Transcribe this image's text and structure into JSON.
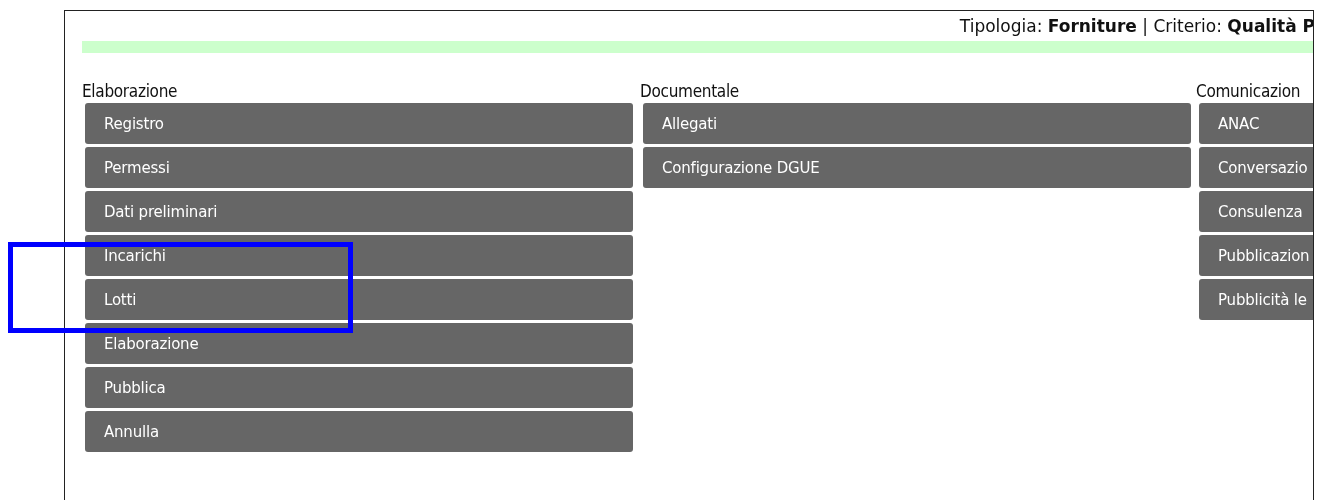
{
  "header": {
    "text": "Tipologia: **Forniture** | Criterio: **Qualità P**"
  },
  "columns": [
    {
      "title": "Elaborazione",
      "items": [
        "Registro",
        "Permessi",
        "Dati preliminari",
        "Incarichi",
        "Lotti",
        "Elaborazione",
        "Pubblica",
        "Annulla"
      ]
    },
    {
      "title": "Documentale",
      "items": [
        "Allegati",
        "Configurazione DGUE"
      ]
    },
    {
      "title": "Comunicazion",
      "items": [
        "ANAC",
        "Conversazio",
        "Consulenza",
        "Pubblicazion",
        "Pubblicità le"
      ]
    }
  ],
  "highlight_box": true
}
